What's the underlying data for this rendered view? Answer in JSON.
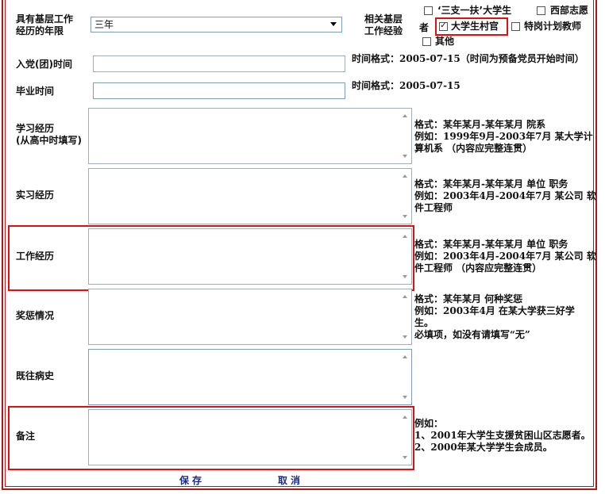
{
  "form": {
    "grassroots_years": {
      "label": "具有基层工作\n经历的年限",
      "selected": "三年"
    },
    "grassroots_experience": {
      "label": "相关基层\n工作经验",
      "suffix": "者",
      "options": [
        {
          "label": "‘三支一扶’大学生",
          "checked": false
        },
        {
          "label": "西部志愿",
          "checked": false
        },
        {
          "label": "大学生村官",
          "checked": true
        },
        {
          "label": "特岗计划教师",
          "checked": false
        },
        {
          "label": "其他",
          "checked": false
        }
      ]
    },
    "party_join": {
      "label": "入党(团)时间",
      "value": "",
      "hint": "时间格式：2005-07-15（时间为预备党员开始时间）"
    },
    "graduation": {
      "label": "毕业时间",
      "value": "",
      "hint": "时间格式：2005-07-15"
    },
    "study": {
      "label": "学习经历\n(从高中时填写)",
      "value": "",
      "hint": "格式：某年某月-某年某月 院系\n例如：1999年9月-2003年7月 某大学计\n算机系 （内容应完整连贯）"
    },
    "internship": {
      "label": "实习经历",
      "value": "",
      "hint": "格式：某年某月-某年某月 单位 职务\n例如：2003年4月-2004年7月 某公司 软\n件工程师"
    },
    "work": {
      "label": "工作经历",
      "value": "",
      "hint": "格式：某年某月-某年某月 单位 职务\n例如：2003年4月-2004年7月 某公司 软\n件工程师 （内容应完整连贯）"
    },
    "awards": {
      "label": "奖惩情况",
      "value": "",
      "hint": "格式：某年某月 何种奖惩\n例如：2003年4月 在某大学获三好学\n生。\n必填项，如没有请填写“无”"
    },
    "medical": {
      "label": "既往病史",
      "value": "",
      "hint": ""
    },
    "remarks": {
      "label": "备注",
      "value": "",
      "hint": "例如：\n1、2001年大学生支援贫困山区志愿者。\n2、2000年某大学学生会成员。"
    }
  },
  "buttons": {
    "save": "保存",
    "cancel": "取消"
  },
  "colors": {
    "frame": "#b31616",
    "highlight": "#e01010",
    "button_text": "#1a2a8a"
  }
}
